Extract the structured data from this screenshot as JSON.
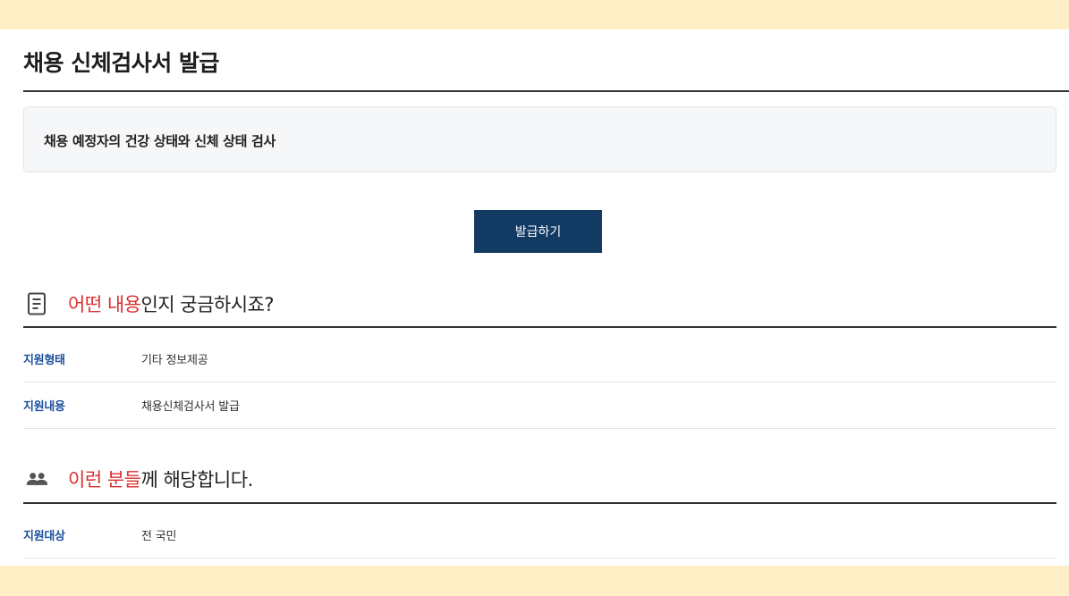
{
  "page": {
    "title": "채용 신체검사서 발급",
    "summary": "채용 예정자의 건강 상태와 신체 상태 검사",
    "issue_button": "발급하기"
  },
  "section_content": {
    "icon": "document-icon",
    "title_accent": "어떤 내용",
    "title_rest": "인지 궁금하시죠?",
    "rows": [
      {
        "label": "지원형태",
        "value": "기타 정보제공"
      },
      {
        "label": "지원내용",
        "value": "채용신체검사서 발급"
      }
    ]
  },
  "section_target": {
    "icon": "people-icon",
    "title_accent": "이런 분들",
    "title_rest": "께 해당합니다.",
    "rows": [
      {
        "label": "지원대상",
        "value": "전 국민"
      }
    ]
  },
  "colors": {
    "band": "#fdeec6",
    "button": "#123a63",
    "accent": "#d8302f",
    "label": "#1b4f9c"
  }
}
